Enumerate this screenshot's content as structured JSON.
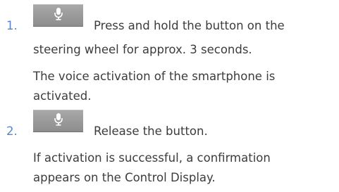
{
  "steps": [
    {
      "number": "1.",
      "button_icon": "microphone-icon",
      "instruction_line1": "Press and hold the button on the",
      "instruction_line2": "steering wheel for approx. 3 seconds.",
      "result_line1": "The voice activation of the smartphone is",
      "result_line2": "activated."
    },
    {
      "number": "2.",
      "button_icon": "microphone-icon",
      "instruction_line1": "Release the button.",
      "result_line1": "If activation is successful, a confirmation",
      "result_line2": "appears on the Control Display."
    }
  ],
  "colors": {
    "step_number": "#5b84c4",
    "text": "#3c3c3c",
    "button": "#9a9a9a"
  }
}
